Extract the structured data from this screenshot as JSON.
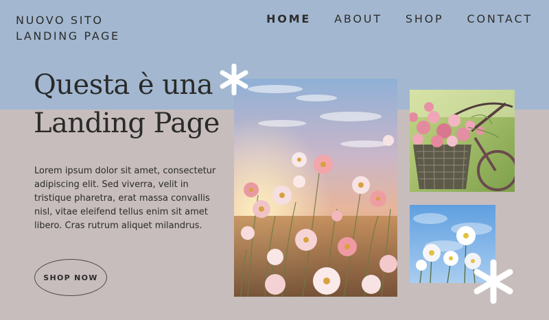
{
  "brand": {
    "line1": "NUOVO SITO",
    "line2": "LANDING PAGE"
  },
  "nav": [
    {
      "label": "HOME",
      "active": true
    },
    {
      "label": "ABOUT",
      "active": false
    },
    {
      "label": "SHOP",
      "active": false
    },
    {
      "label": "CONTACT",
      "active": false
    }
  ],
  "hero": {
    "title_line1": "Questa è una",
    "title_line2": "Landing Page",
    "body": "Lorem ipsum dolor sit amet, consectetur adipiscing elit. Sed viverra, velit in tristique pharetra, erat massa convallis nisl, vitae eleifend tellus enim sit amet libero. Cras rutrum aliquet milandrus.",
    "cta_label": "SHOP NOW"
  },
  "images": [
    {
      "name": "flower-field-photo"
    },
    {
      "name": "bicycle-basket-photo"
    },
    {
      "name": "white-flowers-sky-photo"
    }
  ],
  "decorations": [
    {
      "name": "asterisk-icon"
    }
  ],
  "colors": {
    "top_band": "#a3b8d0",
    "background": "#c7bdbc",
    "text": "#2b2b2b",
    "asterisk": "#ffffff"
  }
}
